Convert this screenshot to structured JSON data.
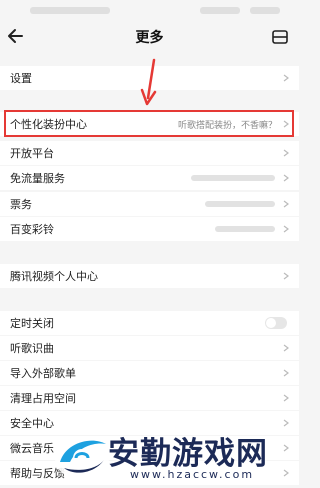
{
  "header": {
    "title": "更多"
  },
  "rows": [
    {
      "label": "设置"
    },
    {
      "label": "个性化装扮中心",
      "hint": "听歌搭配装扮，不香嘛？"
    },
    {
      "label": "开放平台"
    },
    {
      "label": "免流量服务"
    },
    {
      "label": "票务"
    },
    {
      "label": "百变彩铃"
    },
    {
      "label": "腾讯视频个人中心"
    },
    {
      "label": "定时关闭"
    },
    {
      "label": "听歌识曲"
    },
    {
      "label": "导入外部歌单"
    },
    {
      "label": "清理占用空间"
    },
    {
      "label": "安全中心"
    },
    {
      "label": "微云音乐"
    },
    {
      "label": "帮助与反馈"
    }
  ],
  "watermark": {
    "title": "安勤游戏网",
    "url": "www.hzaccw.com"
  },
  "colors": {
    "highlight": "#e53935",
    "watermark": "#1c2a57",
    "accent": "#1ea1e0"
  },
  "icons": [
    "back-arrow-icon",
    "hamburger-menu-icon",
    "chevron-right-icon",
    "red-pointer-arrow",
    "watermark-logo"
  ]
}
